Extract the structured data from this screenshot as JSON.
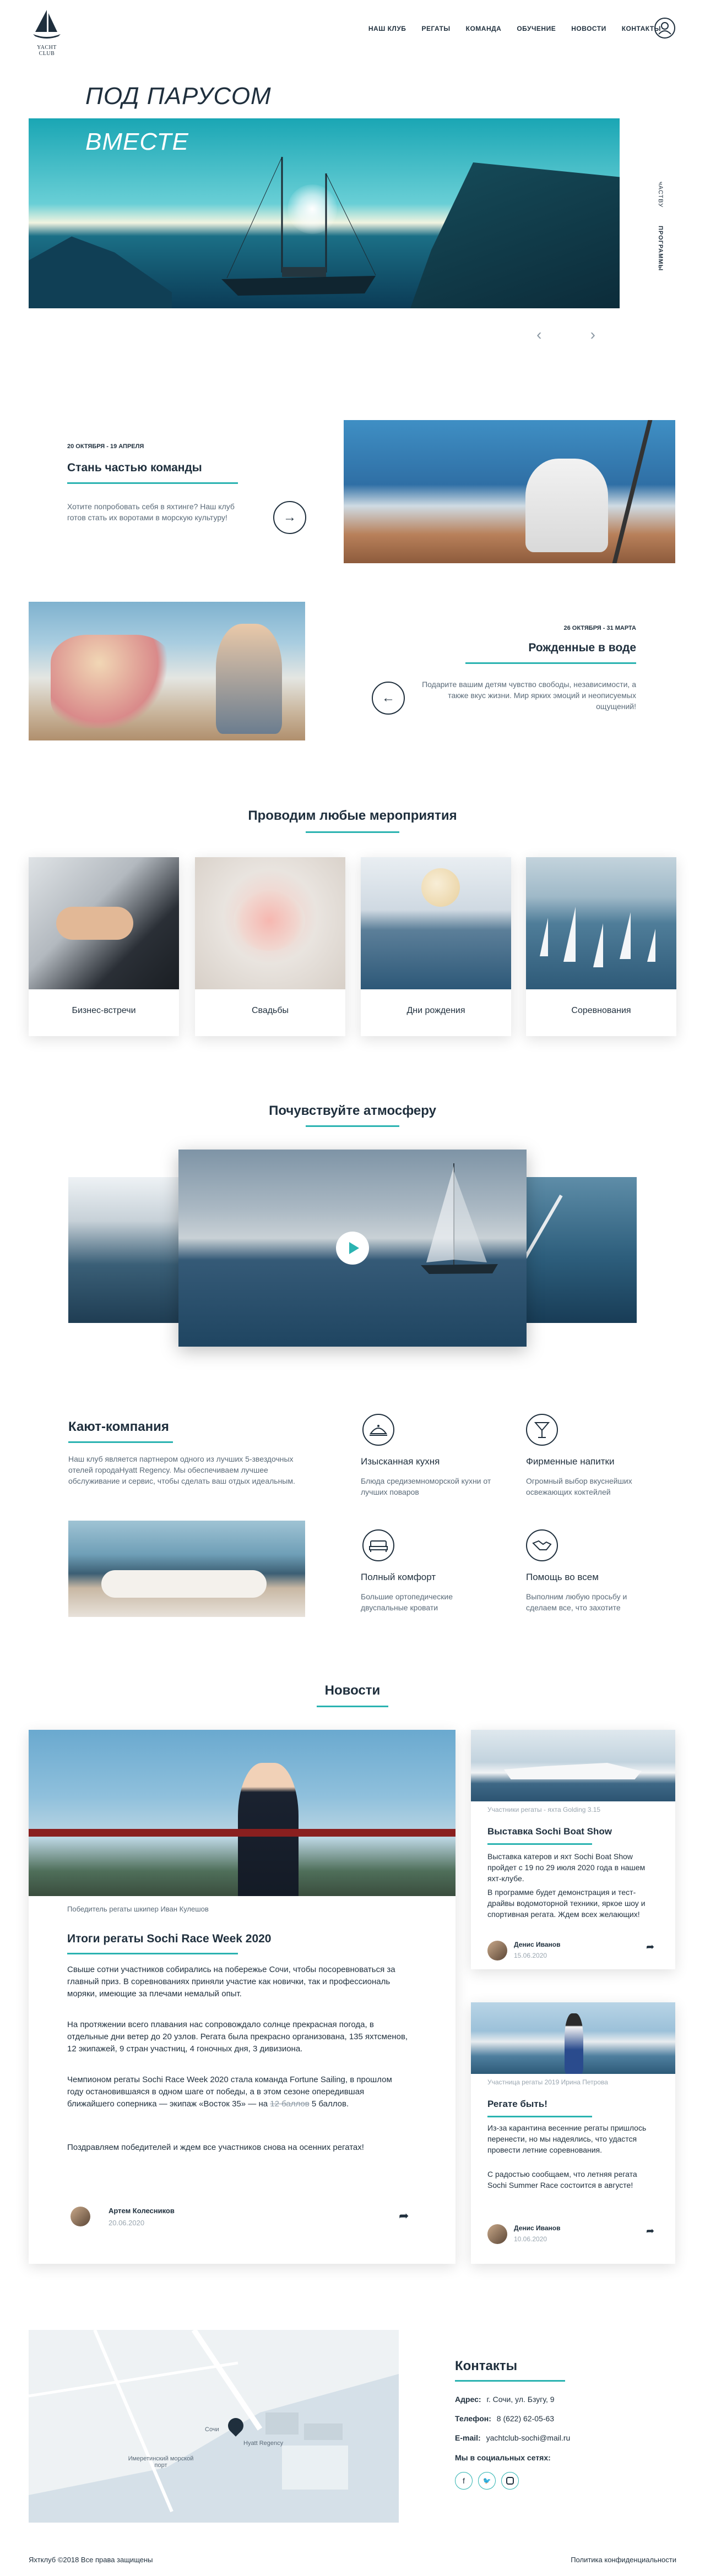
{
  "brand": {
    "logo_text": "YACHT CLUB"
  },
  "nav": {
    "items": [
      "НАШ КЛУБ",
      "РЕГАТЫ",
      "КОМАНДА",
      "ОБУЧЕНИЕ",
      "НОВОСТИ",
      "КОНТАКТЫ"
    ]
  },
  "hero": {
    "title_line1": "ПОД ПАРУСОМ",
    "title_line2": "ВМЕСТЕ",
    "more_label": "СМОТРЕТЬ ДАЛЕЕ",
    "side_tab_top": "чАСТВУ",
    "side_tab_bottom": "ПРОГРАММЫ"
  },
  "promo1": {
    "date": "20 ОКТЯБРЯ - 19 АПРЕЛЯ",
    "title": "Стань частью команды",
    "text": "Хотите попробовать себя в яхтинге? Наш клуб готов стать их воротами в морскую культуру!"
  },
  "promo2": {
    "date": "26 ОКТЯБРЯ - 31 МАРТА",
    "title": "Рожденные в воде",
    "text": "Подарите вашим детям чувство свободы, независимости, а также вкус жизни. Мир ярких эмоций и неописуемых ощущений!"
  },
  "events": {
    "title": "Проводим любые мероприятия",
    "cards": [
      "Бизнес-встречи",
      "Свадьбы",
      "Дни рождения",
      "Соревнования"
    ]
  },
  "atmosphere": {
    "title": "Почувствуйте атмосферу"
  },
  "company": {
    "title": "Кают-компания",
    "text": "Наш клуб является партнером одного из лучших 5-звездочных отелей городаHyatt Regency. Мы обеспечиваем лучшее обслуживание и сервис, чтобы сделать ваш отдых идеальным.",
    "features": [
      {
        "title": "Изысканная кухня",
        "text": "Блюда средиземноморской кухни от лучших поваров",
        "icon": "cloche-icon"
      },
      {
        "title": "Фирменные напитки",
        "text": "Огромный выбор вкуснейших освежающих коктейлей",
        "icon": "cocktail-icon"
      },
      {
        "title": "Полный комфорт",
        "text": "Большие ортопедические двуспальные кровати",
        "icon": "bed-icon"
      },
      {
        "title": "Помощь во всем",
        "text": "Выполним любую просьбу и сделаем все, что захотите",
        "icon": "handshake-icon"
      }
    ]
  },
  "news": {
    "title": "Новости",
    "main": {
      "caption": "Победитель регаты шкипер Иван Кулешов",
      "title": "Итоги регаты Sochi Race Week 2020",
      "p1": "Свыше сотни участников собирались на побережье Сочи, чтобы посоревноваться за главный приз. В соревнованиях приняли участие как новички, так и профессиональ моряки, имеющие за плечами немалый опыт.",
      "p2": "На протяжении всего плавания нас сопровождало солнце прекрасная погода, в отдельные дни ветер до 20 узлов. Регата была прекрасно организована, 135 яхтсменов, 12 экипажей, 9 стран участниц, 4 гоночных дня, 3 дивизиона.",
      "p3_before": "Чемпионом регаты Sochi Race Week 2020 стала команда Fortune Sailing, в прошлом году остановившаяся в одном шаге от победы, а в этом сезоне опередившая ближайшего соперника — экипаж «Восток 35» — на ",
      "p3_strike": "12 баллов",
      "p3_after": " 5 баллов.",
      "p4": "Поздравляем победителей и ждем все участников снова на осенних регатах!",
      "author": "Артем Колесников",
      "date": "20.06.2020"
    },
    "side": [
      {
        "caption": "Участники регаты - яхта Golding 3.15",
        "title": "Выставка Sochi Boat Show",
        "p1": "Выставка катеров и яхт Sochi Boat Show пройдет с 19 по 29 июля 2020 года в нашем яхт-клубе.",
        "p2": "В программе будет демонстрация и тест-драйвы водомоторной техники, яркое шоу и спортивная регата. Ждем всех желающих!",
        "author": "Денис Иванов",
        "date": "15.06.2020"
      },
      {
        "caption": "Участница регаты 2019 Ирина Петрова",
        "title": "Регате быть!",
        "p1": "Из-за карантина весенние регаты пришлось перенести, но мы надеялись, что удастся провести летние соревнования.",
        "p2": "С радостью сообщаем, что летняя регата Sochi Summer Race состоится в августе!",
        "author": "Денис Иванов",
        "date": "10.06.2020"
      }
    ]
  },
  "map": {
    "label_port": "Имеретинский морской порт",
    "label_hotel": "Hyatt Regency",
    "label_street": "Сочи"
  },
  "contacts": {
    "title": "Контакты",
    "address_label": "Адрес:",
    "address": "г. Сочи, ул. Бзугу, 9",
    "phone_label": "Телефон:",
    "phone": "8 (622) 62-05-63",
    "email_label": "E-mail:",
    "email": "yachtclub-sochi@mail.ru",
    "social_label": "Мы в социальных сетях:"
  },
  "footer": {
    "copyright": "Яхтклуб ©2018 Все права защищены",
    "privacy": "Политика конфиденциальности"
  },
  "colors": {
    "accent": "#2bb3b1",
    "dark": "#1f2f3d",
    "muted": "#5a6a78"
  }
}
